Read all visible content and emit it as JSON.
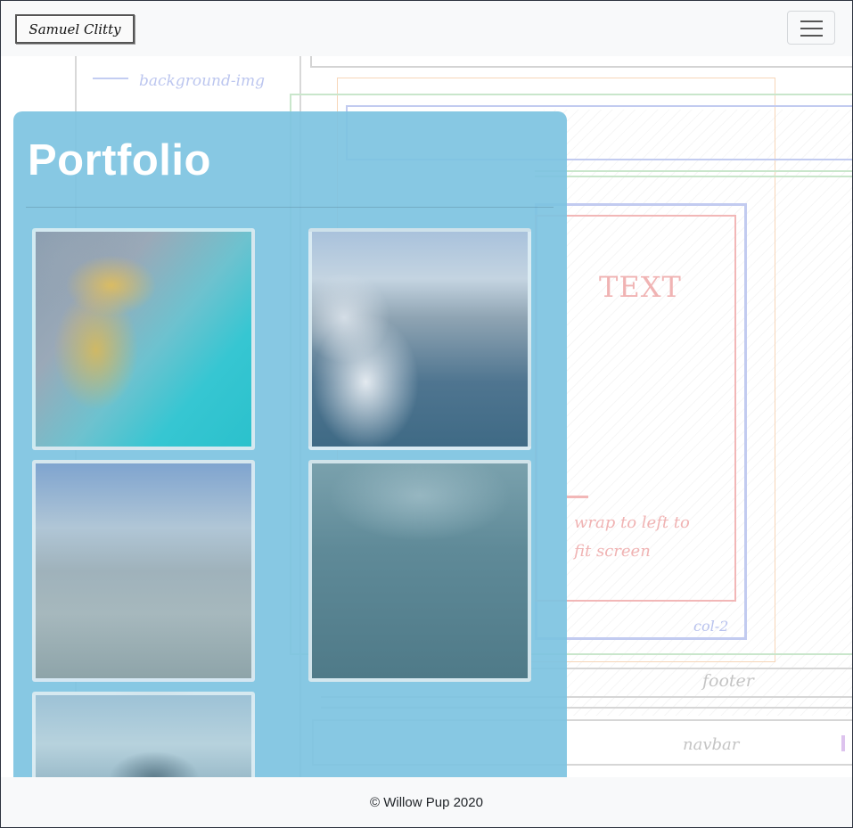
{
  "navbar": {
    "brand": "Samuel Clitty",
    "toggler_icon": "hamburger-menu-icon"
  },
  "sketch": {
    "labels": {
      "background_img": "background-img",
      "text": "TEXT",
      "wrap_note_line1": "wrap to left to",
      "wrap_note_line2": "fit screen",
      "col2": "col-2",
      "footer": "footer",
      "navbar": "navbar"
    }
  },
  "portfolio": {
    "title": "Portfolio",
    "images": [
      {
        "name": "aerial-turquoise-coastline"
      },
      {
        "name": "frosted-trees-river"
      },
      {
        "name": "frosted-forest-aerial"
      },
      {
        "name": "foggy-field-figure"
      },
      {
        "name": "industrial-structure-sky"
      }
    ]
  },
  "footer": {
    "text": "© Willow Pup 2020"
  },
  "colors": {
    "card_bg": "#7dc3e1",
    "navbar_bg": "#f8f9fa",
    "sketch_blue": "#b4c0ee",
    "sketch_red": "#f2b7b7",
    "sketch_green": "#bde3c0"
  }
}
